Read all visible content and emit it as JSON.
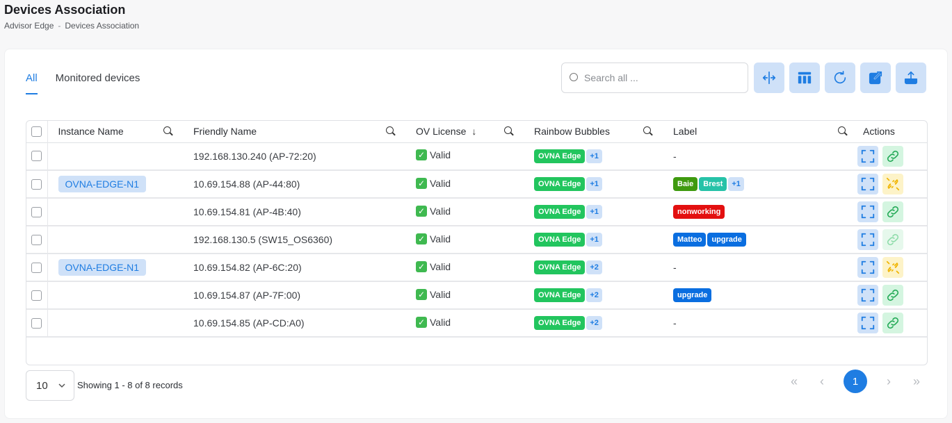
{
  "header": {
    "title": "Devices Association",
    "breadcrumb": [
      "Advisor Edge",
      "Devices Association"
    ],
    "breadcrumb_sep": "-"
  },
  "tabs": [
    {
      "label": "All",
      "active": true
    },
    {
      "label": "Monitored devices",
      "active": false
    }
  ],
  "search": {
    "placeholder": "Search all ..."
  },
  "columns": {
    "instance": "Instance Name",
    "friendly": "Friendly Name",
    "license": "OV License",
    "bubbles": "Rainbow Bubbles",
    "label": "Label",
    "actions": "Actions"
  },
  "rows": [
    {
      "instance": "",
      "friendly": "192.168.130.240 (AP-72:20)",
      "license": "Valid",
      "bubble": "OVNA Edge",
      "bubble_more": "+1",
      "labels": [],
      "dash": "-",
      "link_state": "link"
    },
    {
      "instance": "OVNA-EDGE-N1",
      "friendly": "10.69.154.88 (AP-44:80)",
      "license": "Valid",
      "bubble": "OVNA Edge",
      "bubble_more": "+1",
      "labels": [
        {
          "text": "Baie",
          "color": "olive"
        },
        {
          "text": "Brest",
          "color": "teal"
        },
        {
          "text": "+1",
          "color": "plus"
        }
      ],
      "dash": "",
      "link_state": "unlink"
    },
    {
      "instance": "",
      "friendly": "10.69.154.81 (AP-4B:40)",
      "license": "Valid",
      "bubble": "OVNA Edge",
      "bubble_more": "+1",
      "labels": [
        {
          "text": "nonworking",
          "color": "red"
        }
      ],
      "dash": "",
      "link_state": "link"
    },
    {
      "instance": "",
      "friendly": "192.168.130.5 (SW15_OS6360)",
      "license": "Valid",
      "bubble": "OVNA Edge",
      "bubble_more": "+1",
      "labels": [
        {
          "text": "Matteo",
          "color": "blue"
        },
        {
          "text": "upgrade",
          "color": "blue"
        }
      ],
      "dash": "",
      "link_state": "link-light"
    },
    {
      "instance": "OVNA-EDGE-N1",
      "friendly": "10.69.154.82 (AP-6C:20)",
      "license": "Valid",
      "bubble": "OVNA Edge",
      "bubble_more": "+2",
      "labels": [],
      "dash": "-",
      "link_state": "unlink"
    },
    {
      "instance": "",
      "friendly": "10.69.154.87 (AP-7F:00)",
      "license": "Valid",
      "bubble": "OVNA Edge",
      "bubble_more": "+2",
      "labels": [
        {
          "text": "upgrade",
          "color": "blue"
        }
      ],
      "dash": "",
      "link_state": "link"
    },
    {
      "instance": "",
      "friendly": "10.69.154.85 (AP-CD:A0)",
      "license": "Valid",
      "bubble": "OVNA Edge",
      "bubble_more": "+2",
      "labels": [],
      "dash": "-",
      "link_state": "link"
    }
  ],
  "footer": {
    "page_size": "10",
    "records_text": "Showing 1 - 8 of 8 records",
    "current_page": "1"
  },
  "icons": {
    "search": "search-icon",
    "split": "split-columns-icon",
    "layout": "table-layout-icon",
    "refresh": "refresh-icon",
    "open": "open-external-icon",
    "upload": "upload-icon",
    "expand": "expand-icon",
    "link": "link-icon",
    "unlink": "unlink-icon"
  },
  "colors": {
    "accent": "#1f7de2",
    "chip_bg": "#cfe1f8",
    "green_badge": "#22c55e"
  }
}
